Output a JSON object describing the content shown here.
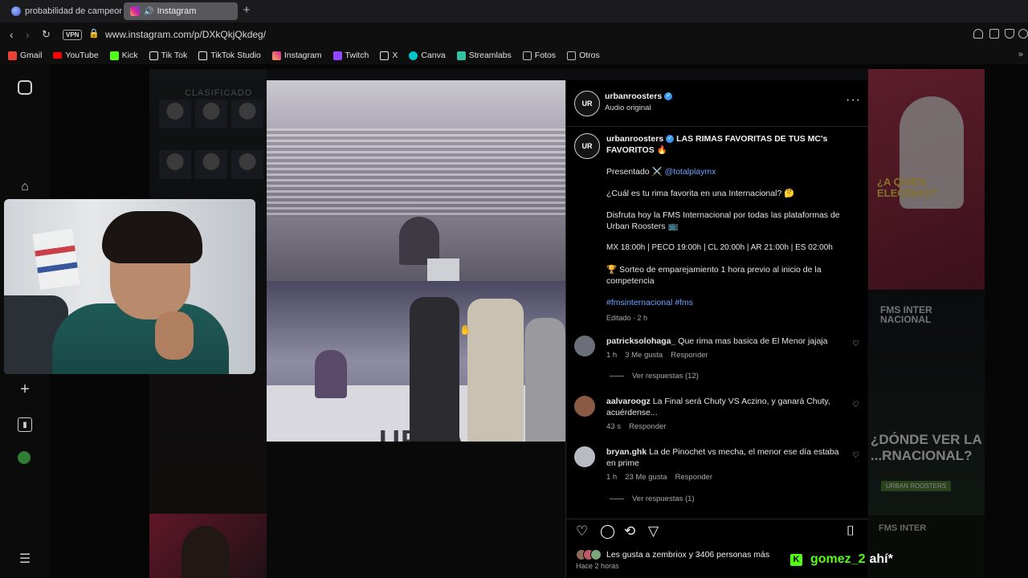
{
  "browser": {
    "tabs": [
      {
        "title": "probabilidad de campeona",
        "active": false
      },
      {
        "title": "Instagram",
        "active": true
      }
    ],
    "new_tab": "+",
    "vpn": "VPN",
    "url": "www.instagram.com/p/DXkQkjQkdeg/"
  },
  "bookmarks": [
    {
      "label": "Gmail",
      "color": "#ea4335"
    },
    {
      "label": "YouTube",
      "color": "#ff0000"
    },
    {
      "label": "Kick",
      "color": "#53fc18"
    },
    {
      "label": "Tik Tok",
      "color": "#e9e9e9"
    },
    {
      "label": "TikTok Studio",
      "color": "#e9e9e9"
    },
    {
      "label": "Instagram",
      "color": "#d6249f"
    },
    {
      "label": "Twitch",
      "color": "#9146ff"
    },
    {
      "label": "X",
      "color": "#e9e9e9"
    },
    {
      "label": "Canva",
      "color": "#00c4cc"
    },
    {
      "label": "Streamlabs",
      "color": "#31c3a2"
    },
    {
      "label": "Fotos",
      "color": "#bdbdbd"
    },
    {
      "label": "Otros",
      "color": "#bdbdbd"
    }
  ],
  "background": {
    "left_title": "CLASIFICADO",
    "right_question": "¿A QUIEN ELEGIRAS?",
    "right_event": "FMS INTER NACIONAL",
    "right_big": "¿DÓNDE VER LA ...RNACIONAL?",
    "right_badge": "URBAN ROOSTERS",
    "right_bottom": "FMS INTER"
  },
  "video": {
    "stage_text": "URBAN ROOS"
  },
  "post": {
    "author": "urbanroosters",
    "author_sub": "Audio original",
    "avatar_text": "UR",
    "caption_title": "LAS RIMAS FAVORITAS DE TUS MC's FAVORITOS 🔥",
    "presented_prefix": "Presentado ⚔️",
    "presented_by": "@totalplaymx",
    "question": "¿Cuál es tu rima favorita en una Internacional? 🤔",
    "promo": "Disfruta hoy la FMS Internacional por todas las plataformas de Urban Roosters 📺",
    "schedule": "MX 18:00h | PECO 19:00h | CL 20:00h | AR 21:00h | ES 02:00h",
    "draw": "🏆 Sorteo de emparejamiento 1 hora previo al inicio de la competencia",
    "hashtags": "#fmsinternacional #fms",
    "edited": "Editado · 2 h"
  },
  "comments": [
    {
      "user": "patricksolohaga_",
      "text": "Que rima mas basica de El Menor jajaja",
      "time": "1 h",
      "likes": "3 Me gusta",
      "reply": "Responder",
      "view_replies": "Ver respuestas (12)",
      "avatar_color": "#6b6f78"
    },
    {
      "user": "aalvaroogz",
      "text": "La Final será Chuty VS Aczino, y ganará Chuty, acuérdense...",
      "time": "43 s",
      "likes": "",
      "reply": "Responder",
      "view_replies": "",
      "avatar_color": "#8a5a44"
    },
    {
      "user": "bryan.ghk",
      "text": "La de Pinochet vs mecha, el menor ese día estaba en prime",
      "time": "1 h",
      "likes": "23 Me gusta",
      "reply": "Responder",
      "view_replies": "Ver respuestas (1)",
      "avatar_color": "#b8bcc2"
    }
  ],
  "likes_text": "Les gusta a zembriox y 3406 personas más",
  "time_ago": "Hace 2 horas",
  "chat": {
    "user": "gomez_2",
    "message": "ahí*",
    "platform": "K"
  }
}
